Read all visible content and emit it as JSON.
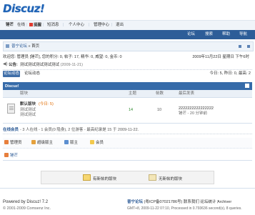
{
  "header": {
    "logo_text": "Discuz!"
  },
  "userbar": {
    "username": "锤芒",
    "status": "在线",
    "alert": "提醒",
    "sms": "短消息",
    "user_center": "个人中心",
    "admin_center": "管理中心",
    "logout": "退出"
  },
  "nav": {
    "items": [
      "论坛",
      "搜索",
      "帮助",
      "导航"
    ]
  },
  "breadcrumb": {
    "forum": "普宁论坛",
    "sep": "»",
    "current": "首页"
  },
  "welcome": {
    "text": "欢迎您: 管理员 [锤芒], 您的积分: 0, 帖子: 17, 精华: 0, 威望: 0, 金币: 0",
    "datetime": "2009年11月22日 星期日 下午6时"
  },
  "announcement": {
    "label": "公告:",
    "text": "测试测试测试测试测试",
    "date": "(2009-11-21)"
  },
  "actions": {
    "new_post": "论坛动态",
    "forum_activity": "论坛动态",
    "today_stats": "今日: 5, 昨日: 0, 最高: 2"
  },
  "forum_table": {
    "title": "Discuz!",
    "columns": [
      "版块",
      "主题",
      "帖数",
      "最后发表"
    ],
    "rows": [
      {
        "name": "默认版块",
        "today": "(今日: 5)",
        "desc1": "测试测试",
        "desc2": "测试测试",
        "topics": "14",
        "posts": "10",
        "last_title": "2222222222222222",
        "last_by": "锤芒 - 20 分钟前"
      }
    ]
  },
  "online": {
    "title": "在线会员",
    "text": "- 3 人在线 - 1 会员(0 隐身), 2 位游客 - 最高纪录是 15 于 2009-11-22.",
    "groups": [
      "管理员",
      "超级版主",
      "版主",
      "会员"
    ],
    "users": [
      "锤芒"
    ]
  },
  "legend": {
    "new_posts": "有新帖的版块",
    "no_new_posts": "无新帖的版块"
  },
  "footer": {
    "powered": "Powered by Discuz! 7.2",
    "copyright": "© 2001-2009 Comsenz Inc.",
    "site_name": "普宁论坛",
    "icp": "(粤ICP备07021786号)",
    "contact": "联系我们",
    "stats": "论坛统计",
    "archiver": "Archiver",
    "gmt": "GMT+8, 2009-11-22 07:10, Processed in 0.793636 second(s), 8 queries."
  },
  "colors": {
    "brand_blue": "#2d5d98",
    "header_blue": "#366ba9",
    "today_orange": "#e06b00",
    "count_green": "#2a8a2a",
    "alert_red": "#e03a2f"
  }
}
